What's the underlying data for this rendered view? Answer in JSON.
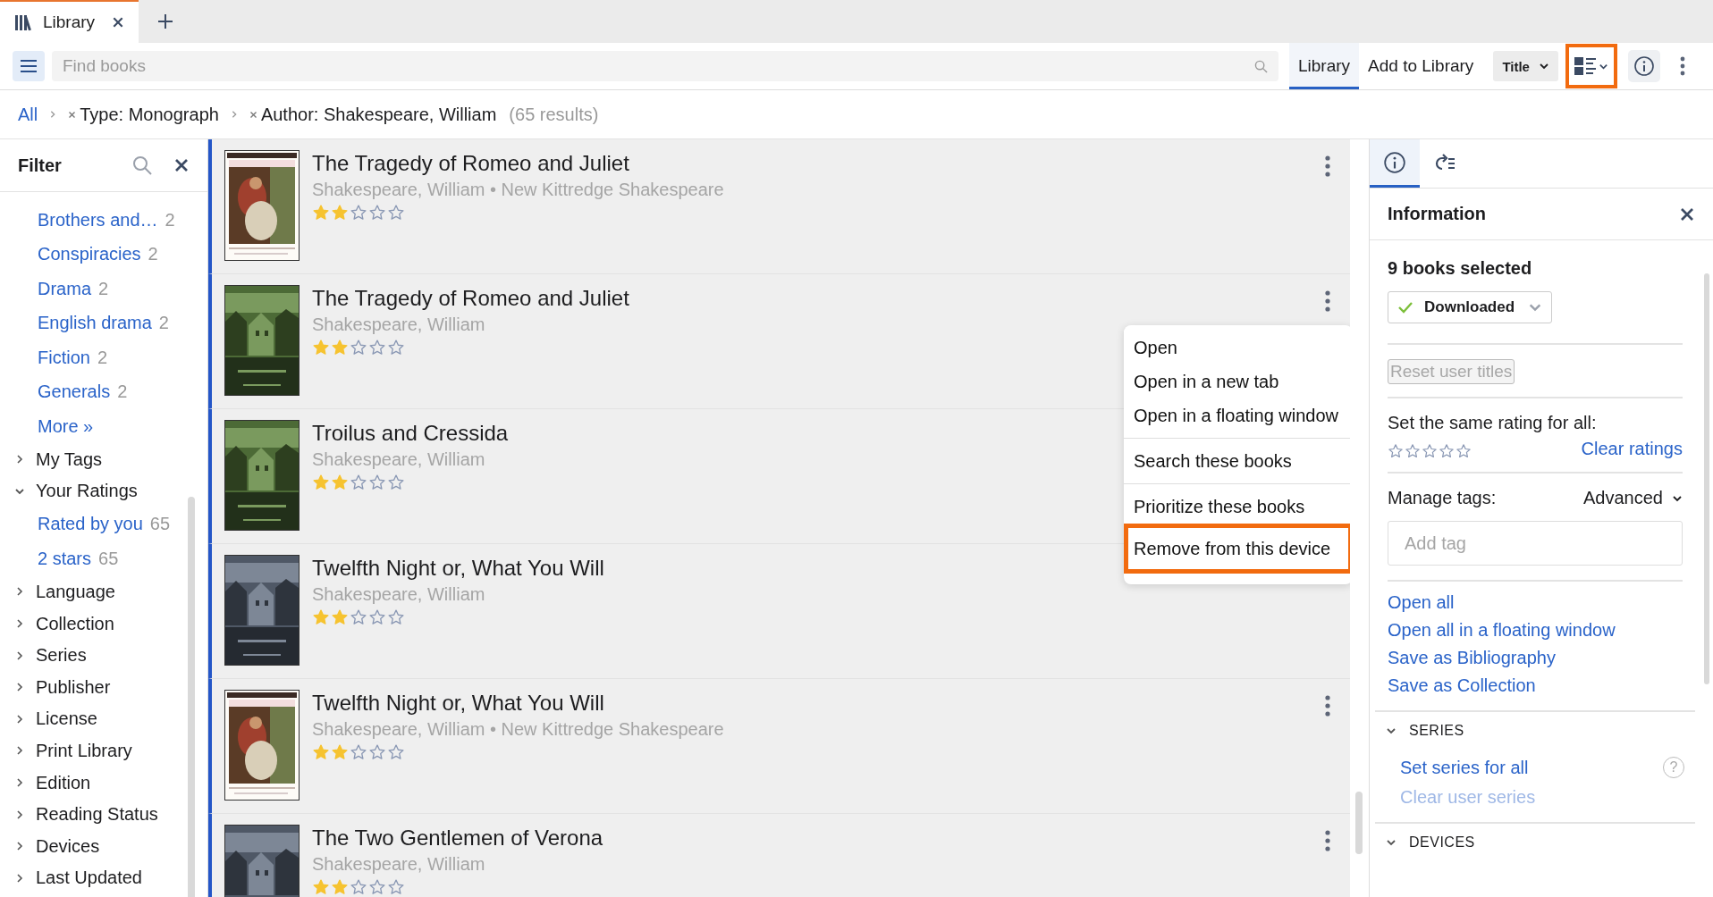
{
  "tabs": [
    {
      "label": "Library",
      "selected": true
    }
  ],
  "toolbar": {
    "search": {
      "placeholder": "Find books"
    },
    "view_tabs": [
      {
        "label": "Library",
        "selected": true
      },
      {
        "label": "Add to Library",
        "selected": false
      }
    ],
    "sort": {
      "value": "Title"
    },
    "view_mode": {
      "highlighted": true
    }
  },
  "breadcrumb": {
    "root": "All",
    "filters": [
      "Type: Monograph",
      "Author: Shakespeare, William"
    ],
    "results": "(65 results)"
  },
  "filter": {
    "title": "Filter",
    "items": [
      {
        "kind": "link",
        "label": "Brothers and…",
        "count": "2"
      },
      {
        "kind": "link",
        "label": "Conspiracies",
        "count": "2"
      },
      {
        "kind": "link",
        "label": "Drama",
        "count": "2"
      },
      {
        "kind": "link",
        "label": "English drama",
        "count": "2"
      },
      {
        "kind": "link",
        "label": "Fiction",
        "count": "2"
      },
      {
        "kind": "link",
        "label": "Generals",
        "count": "2"
      },
      {
        "kind": "link",
        "label": "More »"
      },
      {
        "kind": "group",
        "label": "My Tags",
        "expanded": false
      },
      {
        "kind": "group",
        "label": "Your Ratings",
        "expanded": true
      },
      {
        "kind": "link",
        "label": "Rated by you",
        "count": "65"
      },
      {
        "kind": "link",
        "label": "2 stars",
        "count": "65"
      },
      {
        "kind": "group",
        "label": "Language",
        "expanded": false
      },
      {
        "kind": "group",
        "label": "Collection",
        "expanded": false
      },
      {
        "kind": "group",
        "label": "Series",
        "expanded": false
      },
      {
        "kind": "group",
        "label": "Publisher",
        "expanded": false
      },
      {
        "kind": "group",
        "label": "License",
        "expanded": false
      },
      {
        "kind": "group",
        "label": "Print Library",
        "expanded": false
      },
      {
        "kind": "group",
        "label": "Edition",
        "expanded": false
      },
      {
        "kind": "group",
        "label": "Reading Status",
        "expanded": false
      },
      {
        "kind": "group",
        "label": "Devices",
        "expanded": false
      },
      {
        "kind": "group",
        "label": "Last Updated",
        "expanded": false
      }
    ]
  },
  "books": [
    {
      "title": "The Tragedy of Romeo and Juliet",
      "byline": "Shakespeare, William • New Kittredge Shakespeare",
      "stars": 2,
      "selected": true,
      "menu_open": false
    },
    {
      "title": "The Tragedy of Romeo and Juliet",
      "byline": "Shakespeare, William",
      "stars": 2,
      "selected": true,
      "menu_open": true
    },
    {
      "title": "Troilus and Cressida",
      "byline": "Shakespeare, William",
      "stars": 2,
      "selected": true,
      "menu_open": false
    },
    {
      "title": "Twelfth Night or, What You Will",
      "byline": "Shakespeare, William",
      "stars": 2,
      "selected": true,
      "menu_open": false
    },
    {
      "title": "Twelfth Night or, What You Will",
      "byline": "Shakespeare, William • New Kittredge Shakespeare",
      "stars": 2,
      "selected": true,
      "menu_open": false
    },
    {
      "title": "The Two Gentlemen of Verona",
      "byline": "Shakespeare, William",
      "stars": 2,
      "selected": true,
      "menu_open": false
    }
  ],
  "context_menu": {
    "sections": [
      {
        "items": [
          {
            "label": "Open",
            "highlighted": false
          },
          {
            "label": "Open in a new tab",
            "highlighted": false
          },
          {
            "label": "Open in a floating window",
            "highlighted": false
          }
        ]
      },
      {
        "items": [
          {
            "label": "Search these books",
            "highlighted": false
          }
        ]
      },
      {
        "items": [
          {
            "label": "Prioritize these books",
            "highlighted": false
          },
          {
            "label": "Remove from this device",
            "highlighted": true
          }
        ]
      }
    ]
  },
  "info_panel": {
    "tabs": [
      {
        "kind": "info",
        "selected": true
      },
      {
        "kind": "related",
        "selected": false
      }
    ],
    "title": "Information",
    "selection": "9 books selected",
    "status": {
      "label": "Downloaded",
      "checked": true
    },
    "reset_button": {
      "label": "Reset user titles",
      "disabled": true
    },
    "rating": {
      "label": "Set the same rating for all:",
      "stars": 0,
      "clear": "Clear ratings"
    },
    "tags": {
      "label": "Manage tags:",
      "mode": "Advanced",
      "placeholder": "Add tag"
    },
    "actions": [
      "Open all",
      "Open all in a floating window",
      "Save as Bibliography",
      "Save as Collection"
    ],
    "sections": [
      {
        "title": "SERIES",
        "expanded": true,
        "links": [
          {
            "label": "Set series for all",
            "disabled": false,
            "help": "?"
          },
          {
            "label": "Clear user series",
            "disabled": true
          }
        ]
      },
      {
        "title": "DEVICES",
        "expanded": true
      }
    ]
  }
}
